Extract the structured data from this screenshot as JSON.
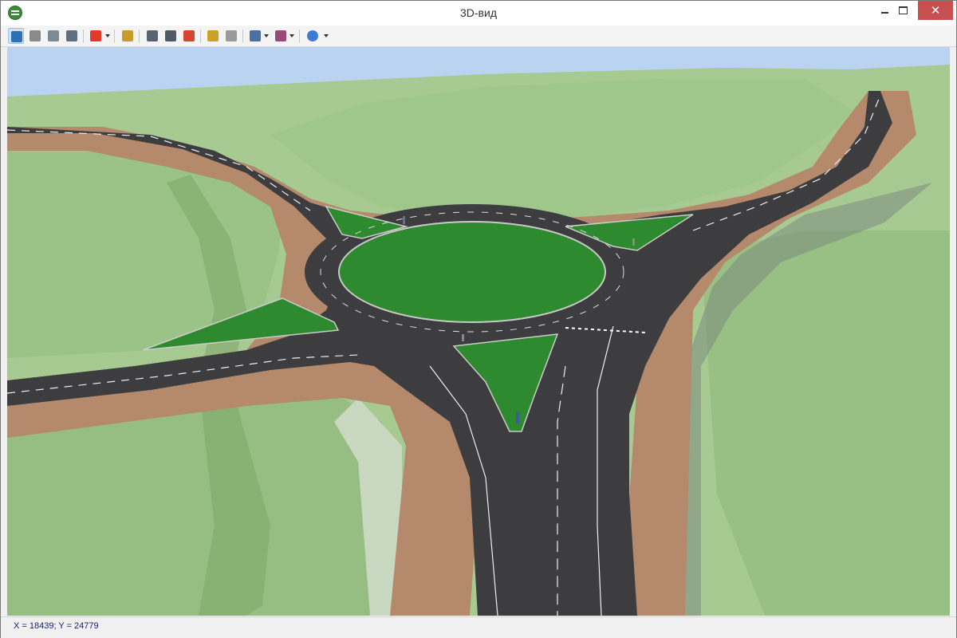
{
  "window": {
    "title": "3D-вид"
  },
  "toolbar": {
    "tools": [
      {
        "name": "pan-move-tool",
        "icon": "move-arrows-icon",
        "active": true,
        "color": "#2f6fb5"
      },
      {
        "name": "hand-tool",
        "icon": "hand-icon",
        "color": "#8a8a8a"
      },
      {
        "name": "camera-view-tool",
        "icon": "camera-view-icon",
        "color": "#7c8a96"
      },
      {
        "name": "drive-tool",
        "icon": "car-icon",
        "color": "#5f6f80"
      },
      {
        "name": "lightning-tool",
        "icon": "lightning-icon",
        "color": "#e03a2a"
      },
      {
        "name": "object-properties-tool",
        "icon": "object-properties-icon",
        "color": "#c89b2a"
      },
      {
        "name": "video-record-tool",
        "icon": "video-camera-icon",
        "color": "#58626e"
      },
      {
        "name": "screenshot-tool",
        "icon": "photo-camera-icon",
        "color": "#4e5a66"
      },
      {
        "name": "render-tool",
        "icon": "color-palette-icon",
        "color": "#d8452f"
      },
      {
        "name": "lighting-tool",
        "icon": "sun-camera-icon",
        "color": "#c9a227"
      },
      {
        "name": "pause-tool",
        "icon": "pause-icon",
        "color": "#9a9a9a"
      },
      {
        "name": "flag-view-tool",
        "icon": "flag-icon",
        "color": "#4a6fa0"
      },
      {
        "name": "save-view-tool",
        "icon": "save-view-icon",
        "color": "#9a4a78"
      },
      {
        "name": "compass-tool",
        "icon": "compass-icon",
        "color": "#3e7bd0"
      }
    ]
  },
  "status": {
    "coordinates": "X = 18439; Y = 24779"
  },
  "colors": {
    "sky": "#b9d3f1",
    "terrain": "#9ec48a",
    "terrain_dark": "#87b273",
    "road": "#3d3d3f",
    "shoulder": "#b4896c",
    "island": "#2e8a2e",
    "marking": "#eeeeee"
  }
}
